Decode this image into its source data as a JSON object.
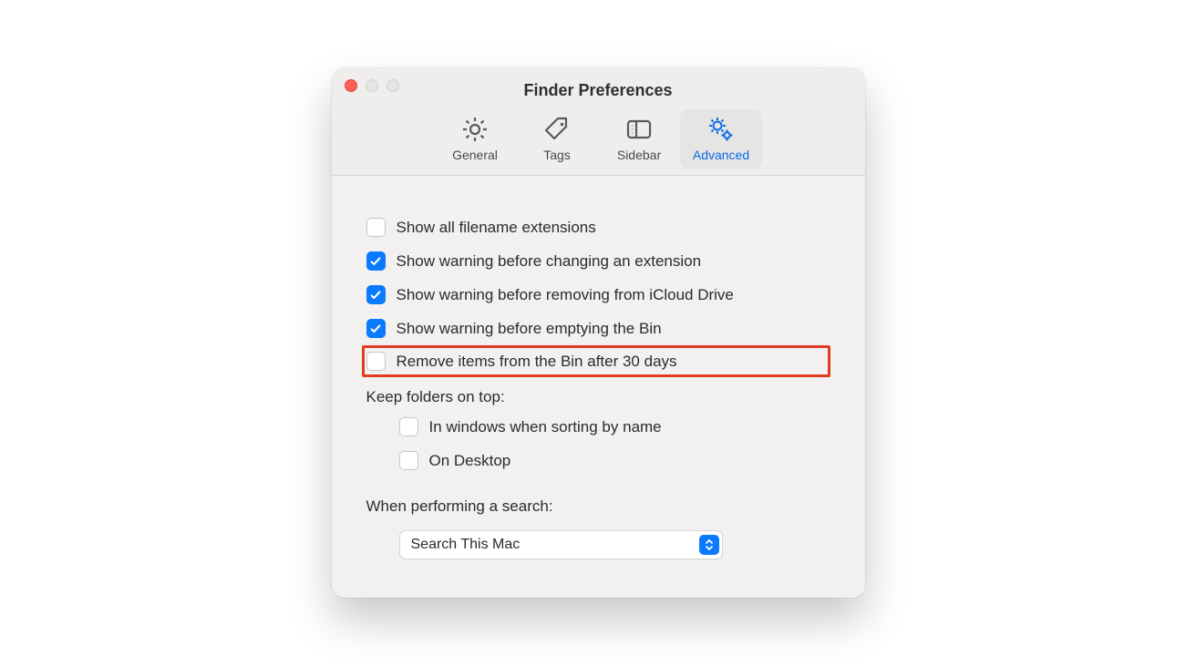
{
  "window": {
    "title": "Finder Preferences"
  },
  "tabs": {
    "general": {
      "label": "General"
    },
    "tags": {
      "label": "Tags"
    },
    "sidebar": {
      "label": "Sidebar"
    },
    "advanced": {
      "label": "Advanced",
      "active": true
    }
  },
  "options": {
    "show_extensions": {
      "label": "Show all filename extensions",
      "checked": false
    },
    "warn_change_ext": {
      "label": "Show warning before changing an extension",
      "checked": true
    },
    "warn_remove_icloud": {
      "label": "Show warning before removing from iCloud Drive",
      "checked": true
    },
    "warn_empty_bin": {
      "label": "Show warning before emptying the Bin",
      "checked": true
    },
    "remove_after_30": {
      "label": "Remove items from the Bin after 30 days",
      "checked": false,
      "highlighted": true
    }
  },
  "keep_on_top": {
    "title": "Keep folders on top:",
    "in_windows": {
      "label": "In windows when sorting by name",
      "checked": false
    },
    "on_desktop": {
      "label": "On Desktop",
      "checked": false
    }
  },
  "search": {
    "title": "When performing a search:",
    "selected": "Search This Mac"
  },
  "colors": {
    "accent": "#0a7aff",
    "highlight_border": "#e13a23"
  }
}
